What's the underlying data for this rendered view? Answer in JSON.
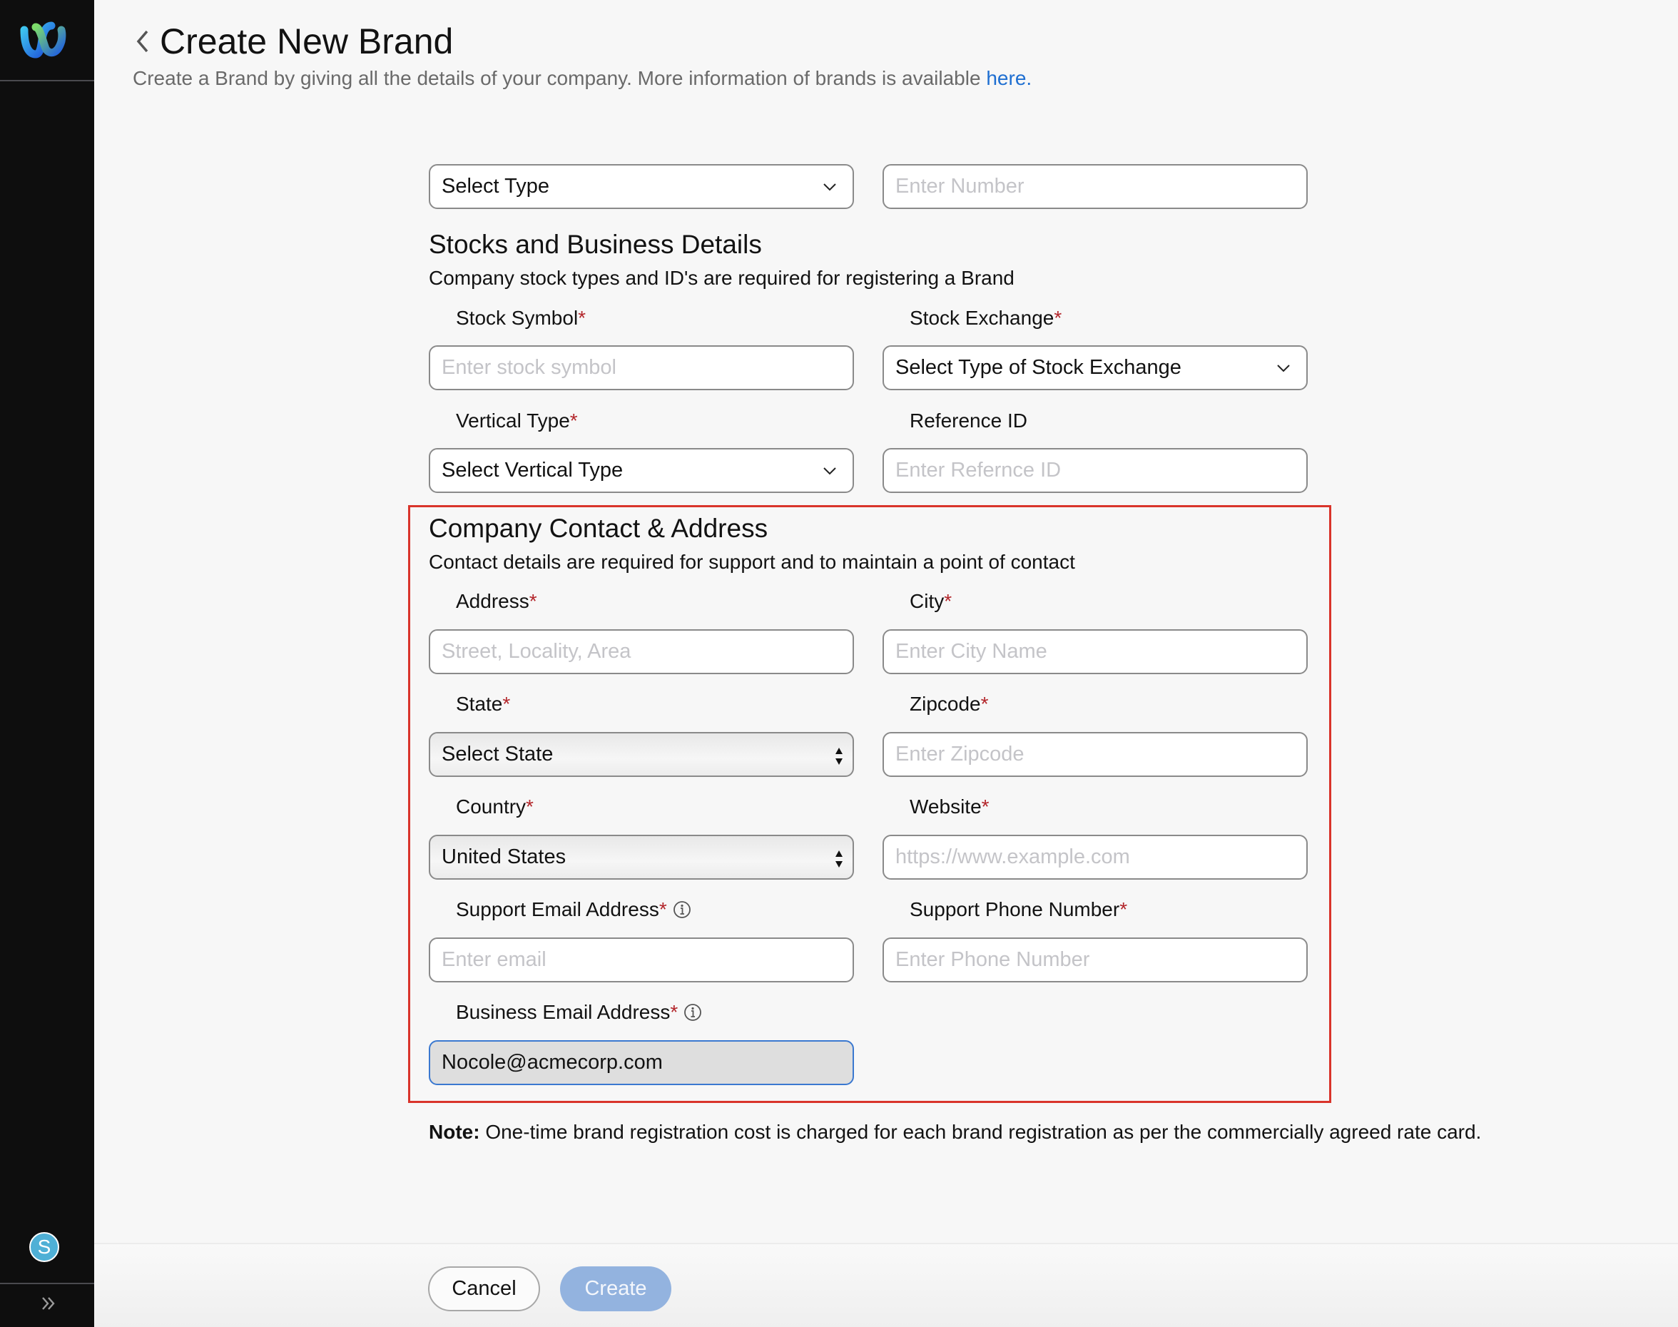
{
  "sidebar": {
    "logo": "webex-logo",
    "avatar_initial": "S",
    "expand_icon": "double-chevron-right-icon"
  },
  "header": {
    "back_icon": "chevron-left-icon",
    "title": "Create New Brand",
    "subtitle": "Create a Brand by giving all the details of your company. More information of brands is available ",
    "subtitle_link": "here."
  },
  "top_row": {
    "type_select": "Select Type",
    "number_placeholder": "Enter Number"
  },
  "stocks_section": {
    "title": "Stocks and Business Details",
    "description": "Company stock types and ID's are required for registering a Brand",
    "stock_symbol": {
      "label": "Stock Symbol",
      "required": "*",
      "placeholder": "Enter stock symbol"
    },
    "stock_exchange": {
      "label": "Stock Exchange",
      "required": "*",
      "selected": "Select Type of Stock Exchange"
    },
    "vertical_type": {
      "label": "Vertical Type",
      "required": "*",
      "selected": "Select Vertical Type"
    },
    "reference_id": {
      "label": "Reference ID",
      "placeholder": "Enter Refernce ID"
    }
  },
  "contact_section": {
    "title": "Company Contact & Address",
    "description": "Contact details are required for support and to maintain a point of contact",
    "address": {
      "label": "Address",
      "required": "*",
      "placeholder": "Street, Locality, Area"
    },
    "city": {
      "label": "City",
      "required": "*",
      "placeholder": "Enter City Name"
    },
    "state": {
      "label": "State",
      "required": "*",
      "selected": "Select State"
    },
    "zipcode": {
      "label": "Zipcode",
      "required": "*",
      "placeholder": "Enter Zipcode"
    },
    "country": {
      "label": "Country",
      "required": "*",
      "selected": "United States"
    },
    "website": {
      "label": "Website",
      "required": "*",
      "placeholder": "https://www.example.com"
    },
    "support_email": {
      "label": "Support Email Address",
      "required": "*",
      "placeholder": "Enter email"
    },
    "support_phone": {
      "label": "Support Phone Number",
      "required": "*",
      "placeholder": "Enter Phone Number"
    },
    "business_email": {
      "label": "Business Email Address",
      "required": "*",
      "value": "Nocole@acmecorp.com"
    }
  },
  "note": {
    "prefix": "Note:",
    "text": " One-time brand registration cost is charged for each brand registration as per the commercially agreed rate card."
  },
  "footer": {
    "cancel_label": "Cancel",
    "create_label": "Create"
  },
  "colors": {
    "accent": "#1f6fd1",
    "required": "#b3262b",
    "highlight_border": "#d9342b",
    "create_disabled": "#93b3df",
    "sidebar_bg": "#0e0e0e"
  }
}
